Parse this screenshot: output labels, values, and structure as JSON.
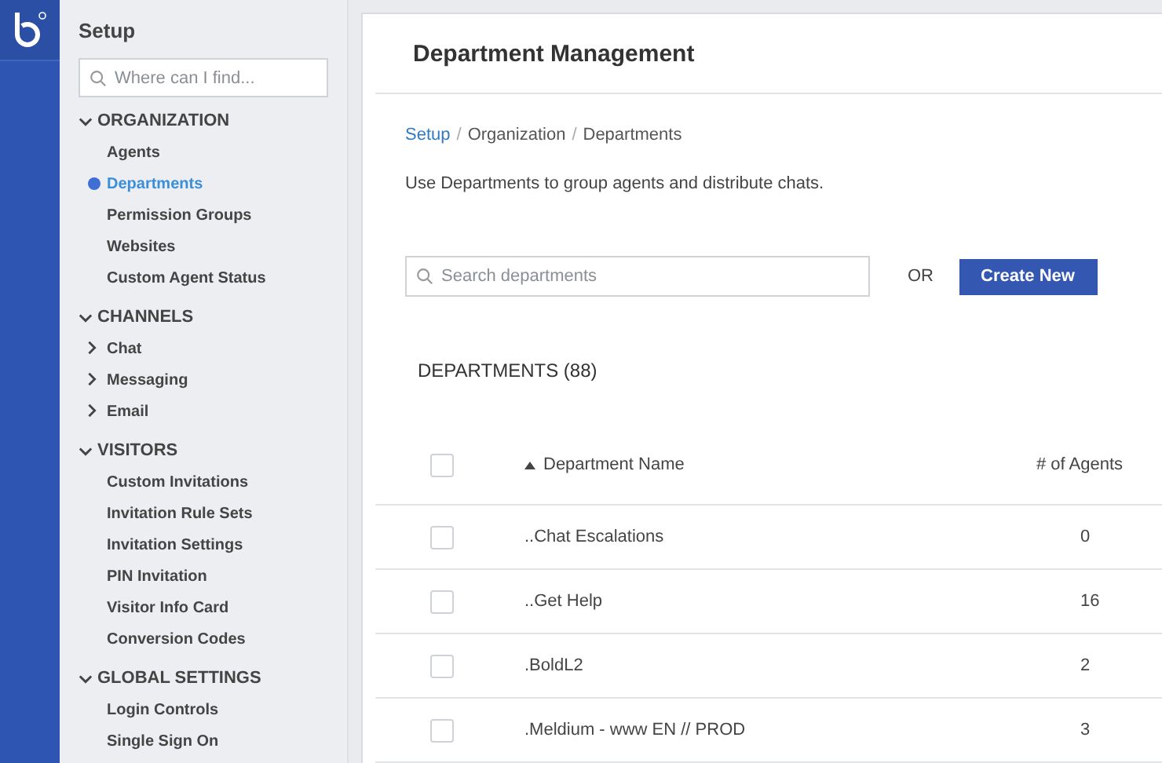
{
  "sidebar": {
    "title": "Setup",
    "search": {
      "placeholder": "Where can I find..."
    },
    "sections": [
      {
        "label": "ORGANIZATION",
        "expanded": true,
        "items": [
          {
            "label": "Agents",
            "kind": "link",
            "selected": false
          },
          {
            "label": "Departments",
            "kind": "link",
            "selected": true
          },
          {
            "label": "Permission Groups",
            "kind": "link",
            "selected": false
          },
          {
            "label": "Websites",
            "kind": "link",
            "selected": false
          },
          {
            "label": "Custom Agent Status",
            "kind": "link",
            "selected": false
          }
        ]
      },
      {
        "label": "CHANNELS",
        "expanded": true,
        "items": [
          {
            "label": "Chat",
            "kind": "group",
            "expanded": false,
            "selected": false
          },
          {
            "label": "Messaging",
            "kind": "group",
            "expanded": false,
            "selected": false
          },
          {
            "label": "Email",
            "kind": "group",
            "expanded": false,
            "selected": false
          }
        ]
      },
      {
        "label": "VISITORS",
        "expanded": true,
        "items": [
          {
            "label": "Custom Invitations",
            "kind": "link",
            "selected": false
          },
          {
            "label": "Invitation Rule Sets",
            "kind": "link",
            "selected": false
          },
          {
            "label": "Invitation Settings",
            "kind": "link",
            "selected": false
          },
          {
            "label": "PIN Invitation",
            "kind": "link",
            "selected": false
          },
          {
            "label": "Visitor Info Card",
            "kind": "link",
            "selected": false
          },
          {
            "label": "Conversion Codes",
            "kind": "link",
            "selected": false
          }
        ]
      },
      {
        "label": "GLOBAL SETTINGS",
        "expanded": true,
        "items": [
          {
            "label": "Login Controls",
            "kind": "link",
            "selected": false
          },
          {
            "label": "Single Sign On",
            "kind": "link",
            "selected": false
          }
        ]
      }
    ]
  },
  "main": {
    "title": "Department Management",
    "breadcrumb": [
      {
        "label": "Setup"
      },
      {
        "separator": "/",
        "label": "Organization"
      },
      {
        "separator": "/",
        "label": "Departments"
      }
    ],
    "description": "Use Departments to group agents and distribute chats.",
    "search": {
      "placeholder": "Search departments"
    },
    "or_label": "OR",
    "create_button": "Create New",
    "list_title": "DEPARTMENTS (88)",
    "table": {
      "select_all": {
        "checked": false
      },
      "columns": [
        {
          "label": "Department Name",
          "sorted": true
        },
        {
          "label": "# of Agents",
          "sorted": false
        }
      ],
      "rows": [
        {
          "name": "..Chat Escalations",
          "agents": "0",
          "checked": false
        },
        {
          "name": "..Get Help",
          "agents": "16",
          "checked": false
        },
        {
          "name": ".BoldL2",
          "agents": "2",
          "checked": false
        },
        {
          "name": ".Meldium - www EN // PROD",
          "agents": "3",
          "checked": false
        }
      ]
    }
  }
}
